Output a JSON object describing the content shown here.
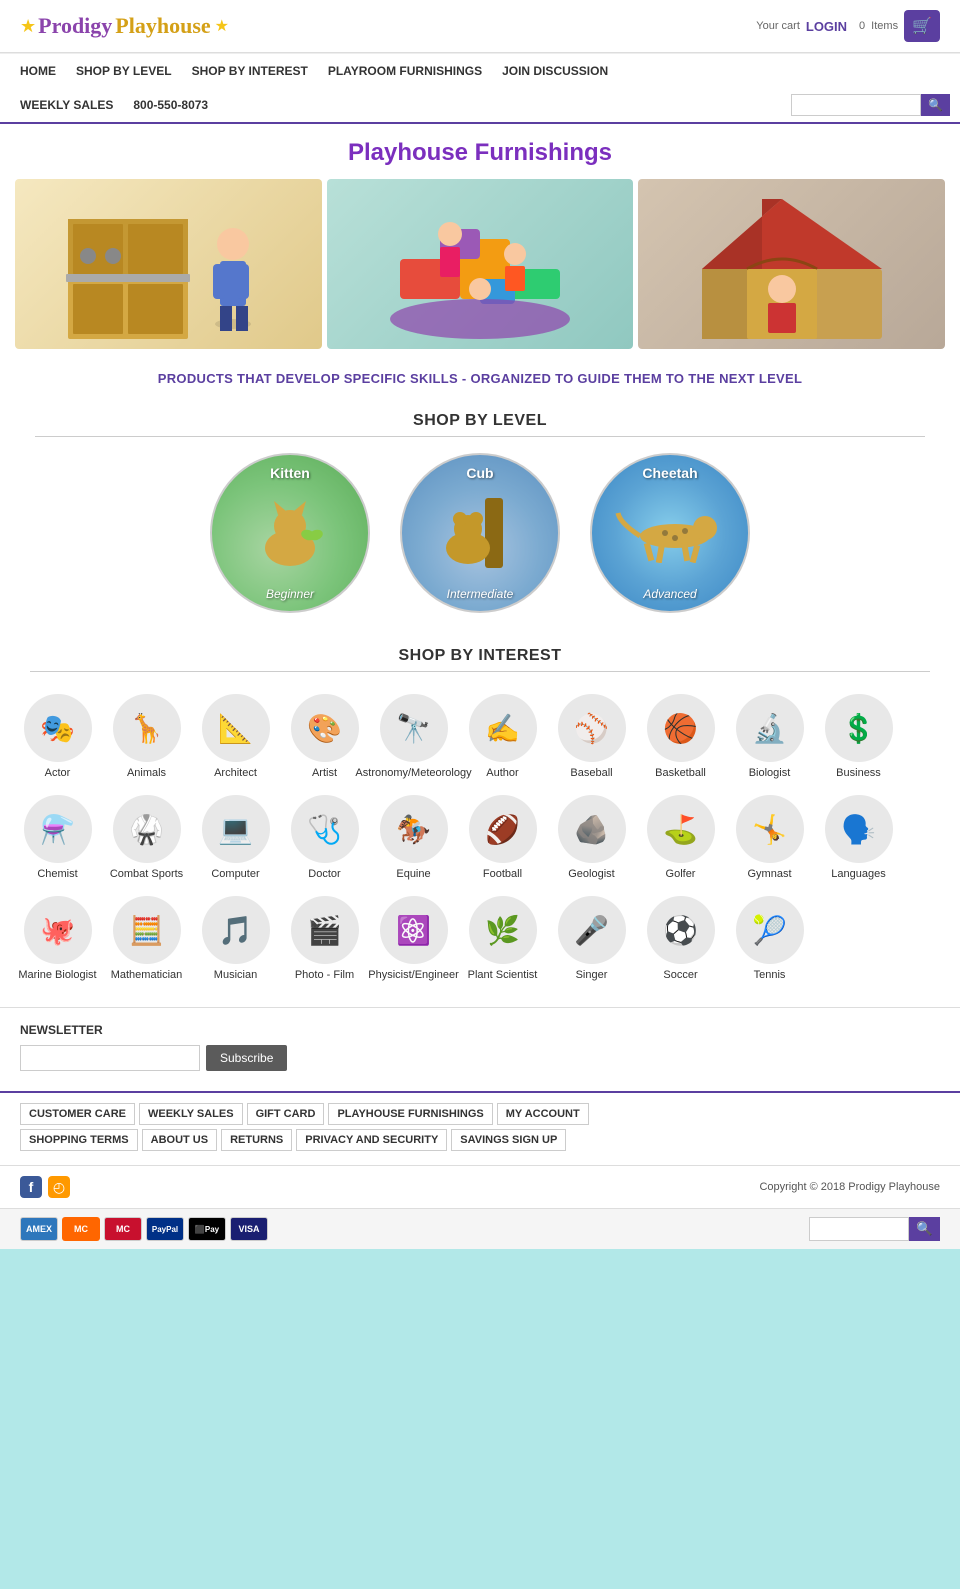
{
  "header": {
    "logo": {
      "prodigy": "Prodigy",
      "playhouse": "Playhouse",
      "cart_label": "Your cart",
      "items_count": "0",
      "items_label": "Items",
      "login_label": "LOGIN"
    }
  },
  "nav": {
    "items": [
      {
        "label": "HOME",
        "id": "home"
      },
      {
        "label": "SHOP BY LEVEL",
        "id": "shop-by-level"
      },
      {
        "label": "SHOP BY INTEREST",
        "id": "shop-by-interest"
      },
      {
        "label": "PLAYROOM FURNISHINGS",
        "id": "playroom-furnishings"
      },
      {
        "label": "JOIN DISCUSSION",
        "id": "join-discussion"
      },
      {
        "label": "WEEKLY SALES",
        "id": "weekly-sales"
      },
      {
        "label": "800-550-8073",
        "id": "phone"
      }
    ],
    "search_placeholder": ""
  },
  "hero": {
    "title": "Playhouse Furnishings",
    "tagline": "PRODUCTS THAT DEVELOP SPECIFIC SKILLS - ORGANIZED TO GUIDE THEM TO THE NEXT LEVEL"
  },
  "shop_by_level": {
    "title": "SHOP BY LEVEL",
    "levels": [
      {
        "id": "kitten",
        "top_label": "Kitten",
        "bottom_label": "Beginner",
        "color": "#7bc47a"
      },
      {
        "id": "cub",
        "top_label": "Cub",
        "bottom_label": "Intermediate",
        "color": "#5a8fc0"
      },
      {
        "id": "cheetah",
        "top_label": "Cheetah",
        "bottom_label": "Advanced",
        "color": "#5ba3d4"
      }
    ]
  },
  "shop_by_interest": {
    "title": "SHOP BY INTEREST",
    "items": [
      {
        "id": "actor",
        "label": "Actor",
        "icon": "🎭"
      },
      {
        "id": "animals",
        "label": "Animals",
        "icon": "🦒"
      },
      {
        "id": "architect",
        "label": "Architect",
        "icon": "📐"
      },
      {
        "id": "artist",
        "label": "Artist",
        "icon": "🎨"
      },
      {
        "id": "astronomy",
        "label": "Astronomy/Meteorology",
        "icon": "🔭"
      },
      {
        "id": "author",
        "label": "Author",
        "icon": "✍️"
      },
      {
        "id": "baseball",
        "label": "Baseball",
        "icon": "⚾"
      },
      {
        "id": "basketball",
        "label": "Basketball",
        "icon": "🏀"
      },
      {
        "id": "biologist",
        "label": "Biologist",
        "icon": "🔬"
      },
      {
        "id": "business",
        "label": "Business",
        "icon": "💲"
      },
      {
        "id": "chemist",
        "label": "Chemist",
        "icon": "⚗️"
      },
      {
        "id": "combat-sports",
        "label": "Combat Sports",
        "icon": "🥋"
      },
      {
        "id": "computer",
        "label": "Computer",
        "icon": "💻"
      },
      {
        "id": "doctor",
        "label": "Doctor",
        "icon": "🩺"
      },
      {
        "id": "equine",
        "label": "Equine",
        "icon": "🏇"
      },
      {
        "id": "football",
        "label": "Football",
        "icon": "🏈"
      },
      {
        "id": "geologist",
        "label": "Geologist",
        "icon": "🪨"
      },
      {
        "id": "golfer",
        "label": "Golfer",
        "icon": "⛳"
      },
      {
        "id": "gymnast",
        "label": "Gymnast",
        "icon": "🤸"
      },
      {
        "id": "languages",
        "label": "Languages",
        "icon": "🗣️"
      },
      {
        "id": "marine-biologist",
        "label": "Marine Biologist",
        "icon": "🐙"
      },
      {
        "id": "mathematician",
        "label": "Mathematician",
        "icon": "🧮"
      },
      {
        "id": "musician",
        "label": "Musician",
        "icon": "🎵"
      },
      {
        "id": "photo-film",
        "label": "Photo - Film",
        "icon": "🎬"
      },
      {
        "id": "physicist",
        "label": "Physicist/Engineer",
        "icon": "⚛️"
      },
      {
        "id": "plant-scientist",
        "label": "Plant Scientist",
        "icon": "🌿"
      },
      {
        "id": "singer",
        "label": "Singer",
        "icon": "🎤"
      },
      {
        "id": "soccer",
        "label": "Soccer",
        "icon": "⚽"
      },
      {
        "id": "tennis",
        "label": "Tennis",
        "icon": "🎾"
      }
    ]
  },
  "newsletter": {
    "title": "NEWSLETTER",
    "button_label": "Subscribe",
    "input_placeholder": ""
  },
  "footer_nav": {
    "row1": [
      {
        "label": "CUSTOMER CARE"
      },
      {
        "label": "WEEKLY SALES"
      },
      {
        "label": "GIFT CARD"
      },
      {
        "label": "PLAYHOUSE FURNISHINGS"
      },
      {
        "label": "MY ACCOUNT"
      }
    ],
    "row2": [
      {
        "label": "SHOPPING TERMS"
      },
      {
        "label": "ABOUT US"
      },
      {
        "label": "RETURNS"
      },
      {
        "label": "PRIVACY AND SECURITY"
      },
      {
        "label": "SAVINGS SIGN UP"
      }
    ]
  },
  "footer": {
    "copyright": "Copyright © 2018 Prodigy Playhouse",
    "social": {
      "facebook": "f",
      "rss": "rss"
    }
  },
  "payment": {
    "icons": [
      "AMEX",
      "MC",
      "VISA",
      "PayPal",
      "Pay",
      "VISA"
    ]
  }
}
